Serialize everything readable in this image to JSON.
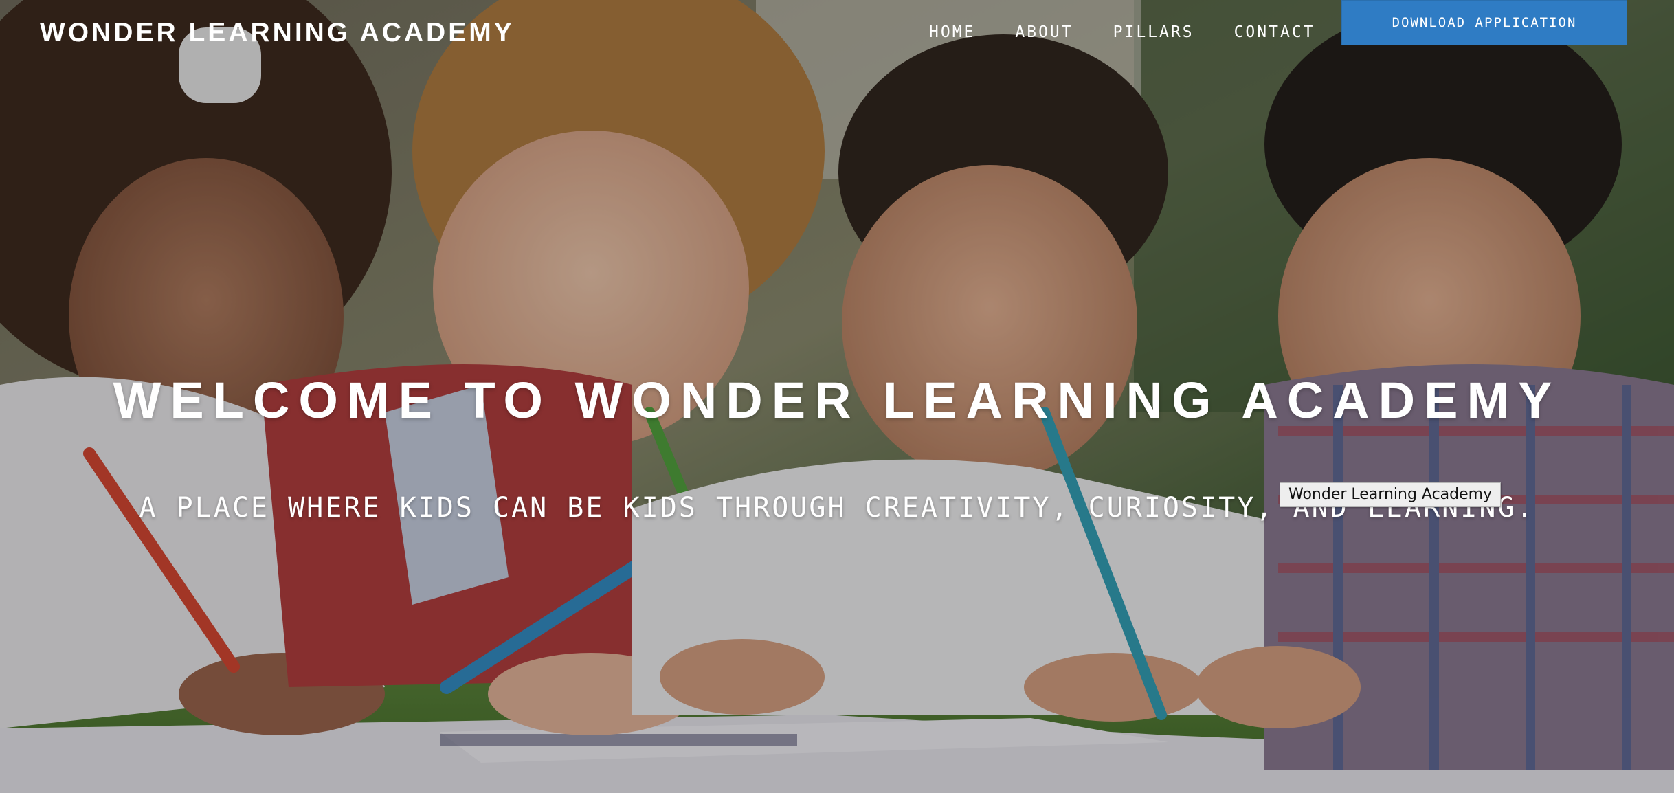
{
  "site": {
    "brand": "WONDER LEARNING ACADEMY"
  },
  "nav": {
    "items": [
      {
        "label": "HOME"
      },
      {
        "label": "ABOUT"
      },
      {
        "label": "PILLARS"
      },
      {
        "label": "CONTACT"
      }
    ],
    "cta_label": "DOWNLOAD APPLICATION"
  },
  "hero": {
    "headline": "WELCOME TO WONDER LEARNING ACADEMY",
    "subheadline": "A PLACE WHERE KIDS CAN BE KIDS THROUGH CREATIVITY, CURIOSITY, AND LEARNING."
  },
  "tooltip": {
    "text": "Wonder Learning Academy"
  },
  "colors": {
    "accent": "#2f7cc4",
    "text": "#ffffff"
  }
}
